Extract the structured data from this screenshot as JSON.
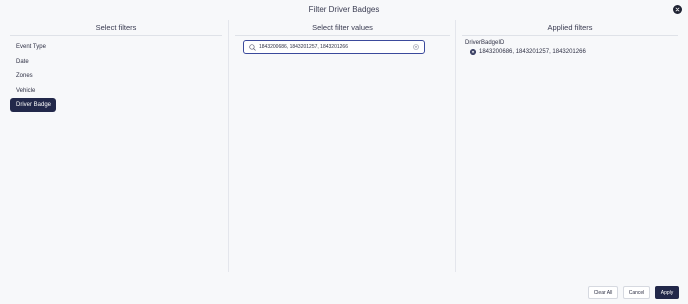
{
  "modal": {
    "title": "Filter Driver Badges"
  },
  "columns": {
    "select_filters": {
      "header": "Select filters",
      "items": [
        "Event Type",
        "Date",
        "Zones",
        "Vehicle",
        "Driver Badge"
      ],
      "active": "Driver Badge"
    },
    "select_values": {
      "header": "Select filter values",
      "search_value": "1843200686, 1843201257, 1843201266"
    },
    "applied_filters": {
      "header": "Applied filters",
      "group_label": "DriverBadgeID",
      "chip_text": "1843200686, 1843201257, 1843201266"
    }
  },
  "footer": {
    "clear_all": "Clear All",
    "cancel": "Cancel",
    "apply": "Apply"
  },
  "colors": {
    "accent": "#22284a",
    "border_focus": "#3b4a9c",
    "background": "#f7f8fa"
  },
  "icons": {
    "close": "close-icon",
    "search": "search-icon",
    "clear": "clear-input-icon",
    "remove_chip": "remove-chip-icon"
  }
}
